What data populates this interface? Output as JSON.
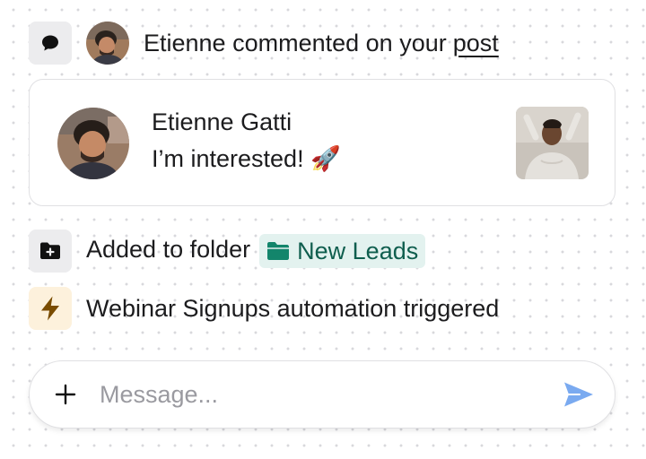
{
  "comment_event": {
    "icon": "comment-icon",
    "actor": "Etienne",
    "action": "commented on your",
    "link_text": "post"
  },
  "comment_card": {
    "author": "Etienne Gatti",
    "message": "I’m interested! 🚀"
  },
  "folder_event": {
    "icon": "folder-add-icon",
    "text": "Added to folder",
    "folder_name": "New Leads",
    "chip_color": "#e3f2ef",
    "chip_text_color": "#0f5e4e"
  },
  "automation_event": {
    "icon": "lightning-icon",
    "automation_name": "Webinar Signups",
    "text": "automation triggered",
    "accent": "#8a5a00"
  },
  "composer": {
    "placeholder": "Message...",
    "value": "",
    "send_color": "#7aaaf0"
  }
}
